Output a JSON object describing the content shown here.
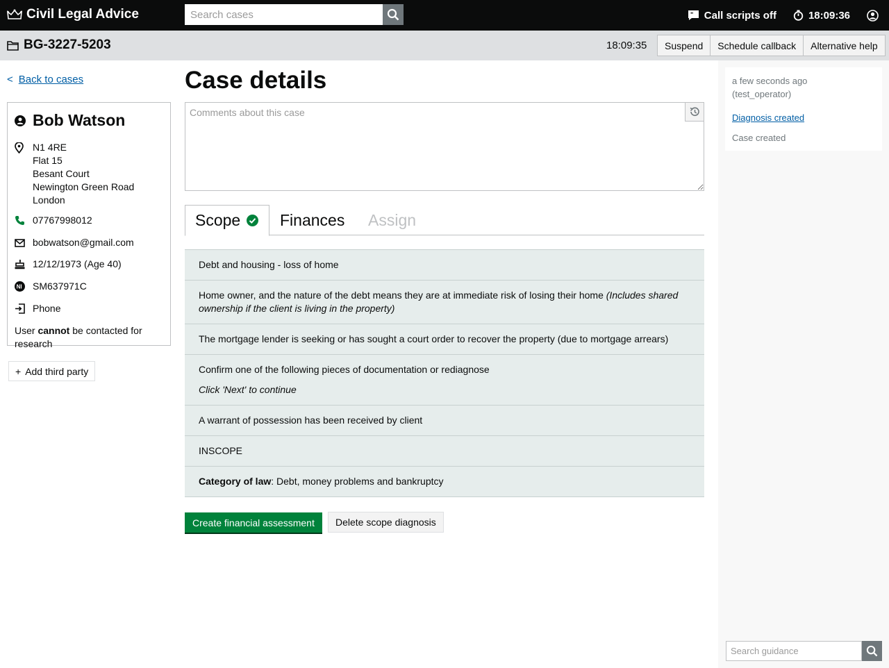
{
  "header": {
    "brand": "Civil Legal Advice",
    "search_placeholder": "Search cases",
    "call_scripts": "Call scripts off",
    "clock": "18:09:36"
  },
  "case": {
    "reference": "BG-3227-5203",
    "timer": "18:09:35",
    "actions": [
      "Suspend",
      "Schedule callback",
      "Alternative help"
    ]
  },
  "sidebar": {
    "back_symbol": "<",
    "back_label": "Back to cases",
    "person": {
      "name": "Bob Watson",
      "address": [
        "N1 4RE",
        "Flat 15",
        "Besant Court",
        "Newington Green Road",
        "London"
      ],
      "phone": "07767998012",
      "email": "bobwatson@gmail.com",
      "dob": "12/12/1973 (Age 40)",
      "ni_number": "SM637971C",
      "contact_method": "Phone",
      "research_prefix": "User ",
      "research_strong": "cannot",
      "research_suffix": " be contacted for research"
    },
    "add_third_party": "Add third party"
  },
  "main": {
    "title": "Case details",
    "comments_placeholder": "Comments about this case",
    "tabs": [
      {
        "label": "Scope",
        "state": "complete"
      },
      {
        "label": "Finances",
        "state": "normal"
      },
      {
        "label": "Assign",
        "state": "disabled"
      }
    ],
    "scope_rows": {
      "r1": "Debt and housing - loss of home",
      "r2": "Home owner, and the nature of the debt means they are at immediate risk of losing their home",
      "r2_note": "(Includes shared ownership if the client is living in the property)",
      "r3": "The mortgage lender is seeking or has sought a court order to recover the property (due to mortgage arrears)",
      "r4": "Confirm one of the following pieces of documentation or rediagnose",
      "r4_sub": "Click 'Next' to continue",
      "r5": "A warrant of possession has been received by client",
      "r6": "INSCOPE",
      "r7_label": "Category of law",
      "r7_value": ": Debt, money problems and bankruptcy"
    },
    "create_button": "Create financial assessment",
    "delete_button": "Delete scope diagnosis"
  },
  "right_panel": {
    "log_time": "a few seconds ago",
    "log_user": "(test_operator)",
    "log_entries": [
      "Diagnosis created",
      "Case created"
    ],
    "guidance_placeholder": "Search guidance"
  },
  "colors": {
    "header_bg": "#0b0c0c",
    "casebar_bg": "#dee0e2",
    "primary_green": "#00823b",
    "link_blue": "#005ea5",
    "scope_row_bg": "#e6edec"
  },
  "icons": [
    "crown-icon",
    "search-icon",
    "call-script-icon",
    "stopwatch-icon",
    "user-account-icon",
    "folder-icon",
    "person-icon",
    "location-icon",
    "phone-icon",
    "email-icon",
    "birthday-icon",
    "ni-icon",
    "contact-method-icon",
    "history-icon",
    "check-icon",
    "plus-icon"
  ]
}
